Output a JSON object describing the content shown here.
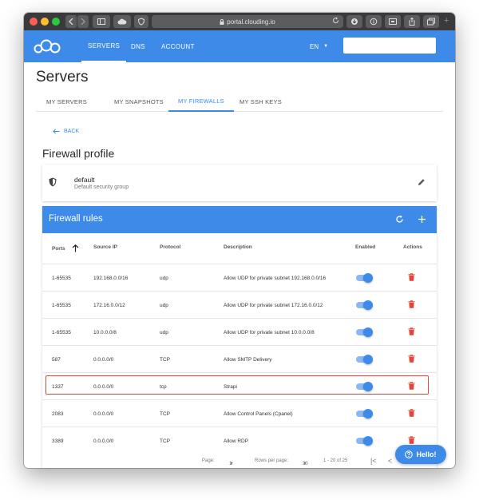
{
  "browser": {
    "url": "portal.clouding.io"
  },
  "header": {
    "nav": [
      "SERVERS",
      "DNS",
      "ACCOUNT"
    ],
    "language": "EN",
    "accent": "#3d8ae8"
  },
  "page": {
    "title": "Servers"
  },
  "tabs": [
    "MY SERVERS",
    "MY SNAPSHOTS",
    "MY FIREWALLS",
    "MY SSH KEYS"
  ],
  "active_tab": "MY FIREWALLS",
  "back_label": "BACK",
  "profile": {
    "heading": "Firewall profile",
    "name": "default",
    "description": "Default security group"
  },
  "rules": {
    "title": "Firewall rules",
    "columns": {
      "ports": "Ports",
      "source_ip": "Source IP",
      "protocol": "Protocol",
      "description": "Description",
      "enabled": "Enabled",
      "actions": "Actions"
    },
    "rows": [
      {
        "ports": "1-65535",
        "source_ip": "192.168.0.0/16",
        "protocol": "udp",
        "description": "Allow UDP for private subnet 192.168.0.0/16",
        "enabled": true
      },
      {
        "ports": "1-65535",
        "source_ip": "172.16.0.0/12",
        "protocol": "udp",
        "description": "Allow UDP for private subnet 172.16.0.0/12",
        "enabled": true
      },
      {
        "ports": "1-65535",
        "source_ip": "10.0.0.0/8",
        "protocol": "udp",
        "description": "Allow UDP for private subnet 10.0.0.0/8",
        "enabled": true
      },
      {
        "ports": "587",
        "source_ip": "0.0.0.0/0",
        "protocol": "TCP",
        "description": "Allow SMTP Delivery",
        "enabled": true
      },
      {
        "ports": "1337",
        "source_ip": "0.0.0.0/0",
        "protocol": "tcp",
        "description": "Strapi",
        "enabled": true,
        "highlighted": true
      },
      {
        "ports": "2083",
        "source_ip": "0.0.0.0/0",
        "protocol": "TCP",
        "description": "Allow Control Panels (Cpanel)",
        "enabled": true
      },
      {
        "ports": "3389",
        "source_ip": "0.0.0.0/0",
        "protocol": "TCP",
        "description": "Allow RDP",
        "enabled": true
      }
    ],
    "pagination": {
      "page_label": "Page:",
      "page": "1",
      "rows_label": "Rows per page:",
      "rows_per_page": "20",
      "range": "1 - 20 of 25"
    }
  },
  "chat": {
    "label": "Hello!"
  }
}
